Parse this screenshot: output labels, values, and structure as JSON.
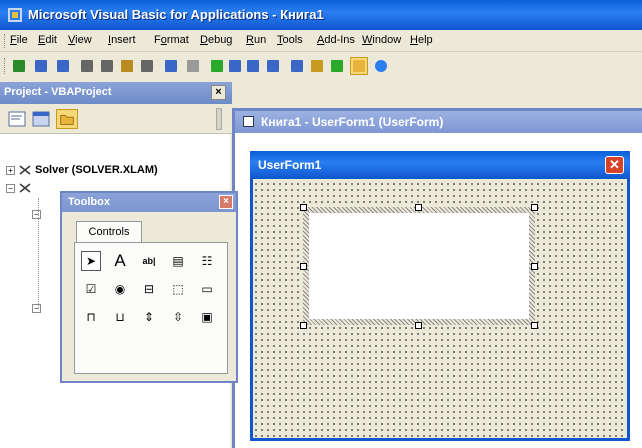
{
  "app": {
    "title": "Microsoft Visual Basic for Applications - Книга1",
    "icon": "vba-app-icon"
  },
  "menu": {
    "items": [
      {
        "label": "File",
        "u": "F"
      },
      {
        "label": "Edit",
        "u": "E"
      },
      {
        "label": "View",
        "u": "V"
      },
      {
        "label": "Insert",
        "u": "I"
      },
      {
        "label": "Format",
        "u": "o"
      },
      {
        "label": "Debug",
        "u": "D"
      },
      {
        "label": "Run",
        "u": "R"
      },
      {
        "label": "Tools",
        "u": "T"
      },
      {
        "label": "Add-Ins",
        "u": "A"
      },
      {
        "label": "Window",
        "u": "W"
      },
      {
        "label": "Help",
        "u": "H"
      }
    ]
  },
  "toolbar": {
    "buttons": [
      "view-excel-icon",
      "insert-userform-icon",
      "save-icon",
      "cut-icon",
      "copy-icon",
      "paste-icon",
      "find-icon",
      "undo-icon",
      "redo-icon",
      "run-icon",
      "break-icon",
      "reset-icon",
      "design-mode-icon",
      "project-explorer-icon",
      "properties-icon",
      "object-browser-icon",
      "toolbox-icon",
      "help-icon"
    ]
  },
  "project": {
    "title": "Project - VBAProject",
    "close_label": "×",
    "tree": [
      {
        "label": "Solver (SOLVER.XLAM)",
        "expander": "+"
      },
      {
        "label": "",
        "expander": "−"
      }
    ]
  },
  "toolbox": {
    "title": "Toolbox",
    "close_label": "×",
    "tab_label": "Controls",
    "controls": [
      {
        "name": "select-objects-icon",
        "glyph": "➤"
      },
      {
        "name": "label-icon",
        "glyph": "A"
      },
      {
        "name": "textbox-icon",
        "glyph": "ab|"
      },
      {
        "name": "combobox-icon",
        "glyph": "▤"
      },
      {
        "name": "listbox-icon",
        "glyph": "☷"
      },
      {
        "name": "checkbox-icon",
        "glyph": "☑"
      },
      {
        "name": "optionbutton-icon",
        "glyph": "◉"
      },
      {
        "name": "togglebutton-icon",
        "glyph": "⊟"
      },
      {
        "name": "frame-icon",
        "glyph": "⬚"
      },
      {
        "name": "commandbutton-icon",
        "glyph": "▭"
      },
      {
        "name": "tabstrip-icon",
        "glyph": "⊓"
      },
      {
        "name": "multipage-icon",
        "glyph": "⊔"
      },
      {
        "name": "scrollbar-icon",
        "glyph": "⇕"
      },
      {
        "name": "spinbutton-icon",
        "glyph": "⇳"
      },
      {
        "name": "image-icon",
        "glyph": "▣"
      }
    ]
  },
  "mdi": {
    "title": "Книга1 - UserForm1 (UserForm)"
  },
  "userform": {
    "title": "UserForm1",
    "close_label": "✕"
  }
}
